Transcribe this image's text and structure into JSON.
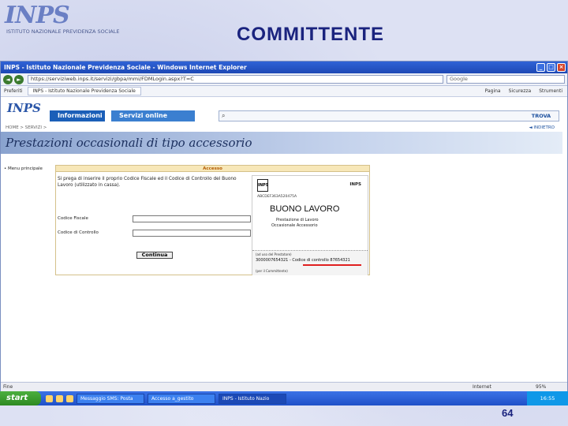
{
  "slide": {
    "logo_text": "INPS",
    "logo_subtitle": "ISTITUTO NAZIONALE PREVIDENZA SOCIALE",
    "title": "COMMITTENTE",
    "page_number": "64"
  },
  "browser": {
    "title": "INPS - Istituto Nazionale Previdenza Sociale - Windows Internet Explorer",
    "url": "https://serviziweb.inps.it/servizi/gbpa/mmi/FDMLogin.aspx?T=C",
    "search_placeholder": "Google",
    "tab_favorites": "Preferiti",
    "tab_page": "INPS - Istituto Nazionale Previdenza Sociale",
    "commands": [
      "Pagina",
      "Sicurezza",
      "Strumenti"
    ],
    "status_left": "Fine",
    "status_zone": "Internet",
    "status_zoom": "95%"
  },
  "site": {
    "logo": "INPS",
    "menu_info": "Informazioni",
    "menu_services": "Servizi online",
    "search_button": "TROVA",
    "breadcrumb": "HOME > SERVIZI > ",
    "back_link": "◄ INDIETRO",
    "hero_title": "Prestazioni occasionali di tipo accessorio",
    "side_menu": "• Menu principale"
  },
  "form": {
    "header": "Accesso",
    "message": "Si prega di inserire il proprio Codice Fiscale ed il Codice di Controllo del Buono Lavoro (utilizzato in cassa).",
    "label_fiscal": "Codice Fiscale",
    "label_control": "Codice di Controllo",
    "continue_label": "Continua"
  },
  "voucher": {
    "logo": "INPS",
    "inps_text": "INPS",
    "code": "ABCDEF363A520475A",
    "title": "BUONO LAVORO",
    "sub1": "Prestazione di Lavoro",
    "sub2": "Occasionale Accessorio",
    "bottom_label": "(ad uso del Prestatore)",
    "bottom_code": "3000007654321 - Codice di controllo 87654321",
    "bottom_footer": "(per il Committente)"
  },
  "taskbar": {
    "start": "start",
    "tasks": [
      "Messaggio SMS: Posta",
      "Accesso a_gestito",
      "INPS - Istituto Nazio"
    ],
    "clock": "16:55"
  },
  "colors": {
    "slide_title": "#1a237e",
    "accent_blue": "#1b5fb8",
    "red_underline": "#e02020"
  }
}
